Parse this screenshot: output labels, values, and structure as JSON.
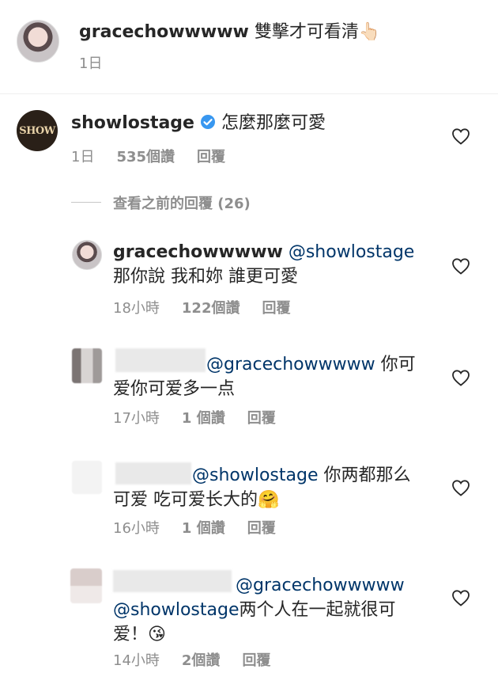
{
  "top_comment": {
    "username": "gracechowwwww",
    "text": "雙擊才可看清",
    "emoji": "👆🏻",
    "time": "1日"
  },
  "main_comment": {
    "username": "showlostage",
    "verified": true,
    "avatar_text": "SHOW",
    "text": "怎麼那麼可愛",
    "time": "1日",
    "likes": "535個讚",
    "reply_label": "回覆"
  },
  "view_previous": "查看之前的回覆 (26)",
  "replies": [
    {
      "username": "gracechowwwww",
      "mention": "@showlostage",
      "text": "那你說 我和妳 誰更可愛",
      "time": "18小時",
      "likes": "122個讚",
      "reply_label": "回覆"
    },
    {
      "username": "",
      "mention": "@gracechowwwww",
      "text_line1": "你可",
      "text_line2": "爱你可爱多一点",
      "time": "17小時",
      "likes": "1 個讚",
      "reply_label": "回覆"
    },
    {
      "username": "",
      "mention": "@showlostage",
      "text_line1": "你两都那么",
      "text_line2": "可爱 吃可爱长大的",
      "emoji": "🤗",
      "time": "16小時",
      "likes": "1 個讚",
      "reply_label": "回覆"
    },
    {
      "username": "",
      "mention": "@gracechowwwww",
      "mention2": "@showlostage",
      "text_line1": "两个人在一起就很可",
      "text_line2": "爱！",
      "emoji": "😘",
      "time": "14小時",
      "likes": "2個讚",
      "reply_label": "回覆"
    }
  ],
  "colors": {
    "text": "#262626",
    "meta": "#8e8e8e",
    "mention": "#003569",
    "verified": "#3897f0"
  }
}
